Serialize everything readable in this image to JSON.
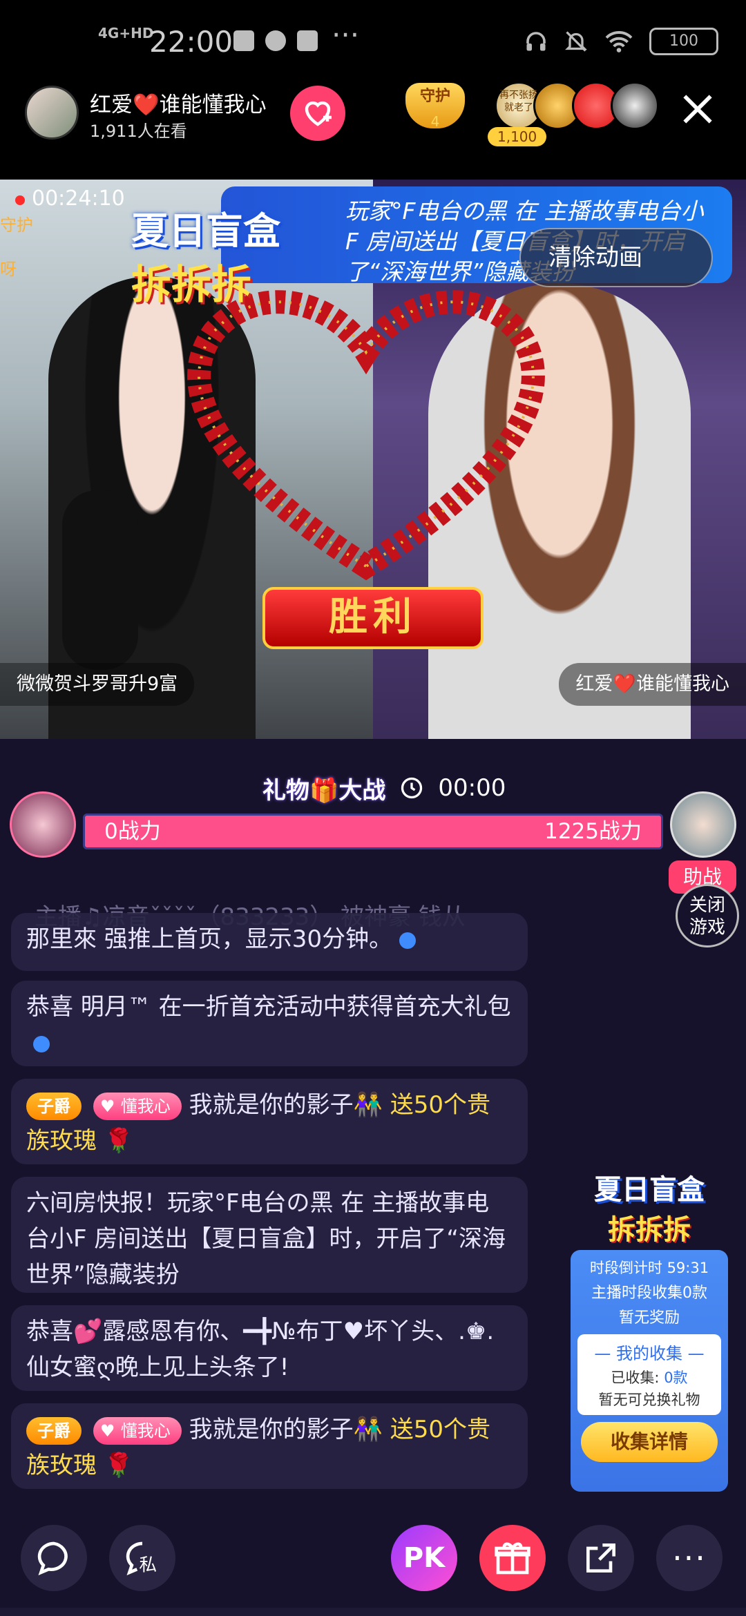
{
  "status_bar": {
    "network": "4G+HD",
    "time": "22:00",
    "dots": "···",
    "battery": "100"
  },
  "room": {
    "host_name": "红爱❤️谁能懂我心",
    "viewers": "1,911人在看",
    "follow_icon": "heart-plus-icon",
    "guard_label": "守护",
    "guard_level": "4",
    "top_fan_label": "再不张扬就老了",
    "top_fan_score": "1,100",
    "close_icon": "close-icon"
  },
  "video": {
    "record_time": "00:24:10",
    "left_side_label_1": "守护",
    "left_side_label_2": "呀",
    "blind_box_title_1": "夏日盲盒",
    "blind_box_title_2": "拆拆拆",
    "notice": "玩家°F电台の黑 在 主播故事电台小F 房间送出【夏日盲盒】时，开启了“深海世界”隐藏装扮",
    "clear_animation": "清除动画",
    "victory": "胜利",
    "left_anchor": "微微贺斗罗哥升9富",
    "right_anchor": "红爱❤️谁能懂我心"
  },
  "pk": {
    "title": "礼物🎁大战",
    "timer": "00:00",
    "left_power": "0战力",
    "right_power": "1225战力",
    "assist": "助战",
    "close_game": "关闭\n游戏"
  },
  "chat": {
    "faded_line": "主播♫凉音ˇˇˇˇ（833233） 被神豪 钱从",
    "messages": [
      {
        "text": "那里來 强推上首页，显示30分钟。"
      },
      {
        "text": "恭喜 明月™ 在一折首充活动中获得首充大礼包"
      },
      {
        "badge1": "子爵",
        "badge2": "懂我心",
        "text": "我就是你的影子👫",
        "highlight": "送50个贵族玫瑰",
        "emoji": "🌹"
      },
      {
        "text": "  六间房快报！玩家°F电台の黑 在 主播故事电台小F 房间送出【夏日盲盒】时，开启了“深海世界”隐藏装扮"
      },
      {
        "text": "恭喜💕露感恩有你、━╋№布丁♥坏丫头、.♚.仙女蜜ღ晚上见上头条了!"
      },
      {
        "badge1": "子爵",
        "badge2": "懂我心",
        "text": "我就是你的影子👫",
        "highlight": "送50个贵族玫瑰",
        "emoji": "🌹"
      }
    ]
  },
  "widget": {
    "title_1": "夏日盲盒",
    "title_2": "拆拆拆",
    "countdown": "时段倒计时 59:31",
    "collect": "主播时段收集0款",
    "no_reward": "暂无奖励",
    "mine": "— 我的收集 —",
    "collected_label": "已收集: ",
    "collected_value": "0款",
    "none": "暂无可兑换礼物",
    "details_button": "收集详情"
  },
  "bottom_bar": {
    "chat_icon": "chat-bubble-icon",
    "private_label": "私",
    "pk_label": "PK",
    "gift_icon": "gift-icon",
    "share_icon": "share-icon",
    "more_label": "···"
  },
  "colors": {
    "accent_pink": "#ff3f6e",
    "background": "#17122b",
    "gold": "#ffdc4e",
    "blue": "#2d6ff0"
  }
}
